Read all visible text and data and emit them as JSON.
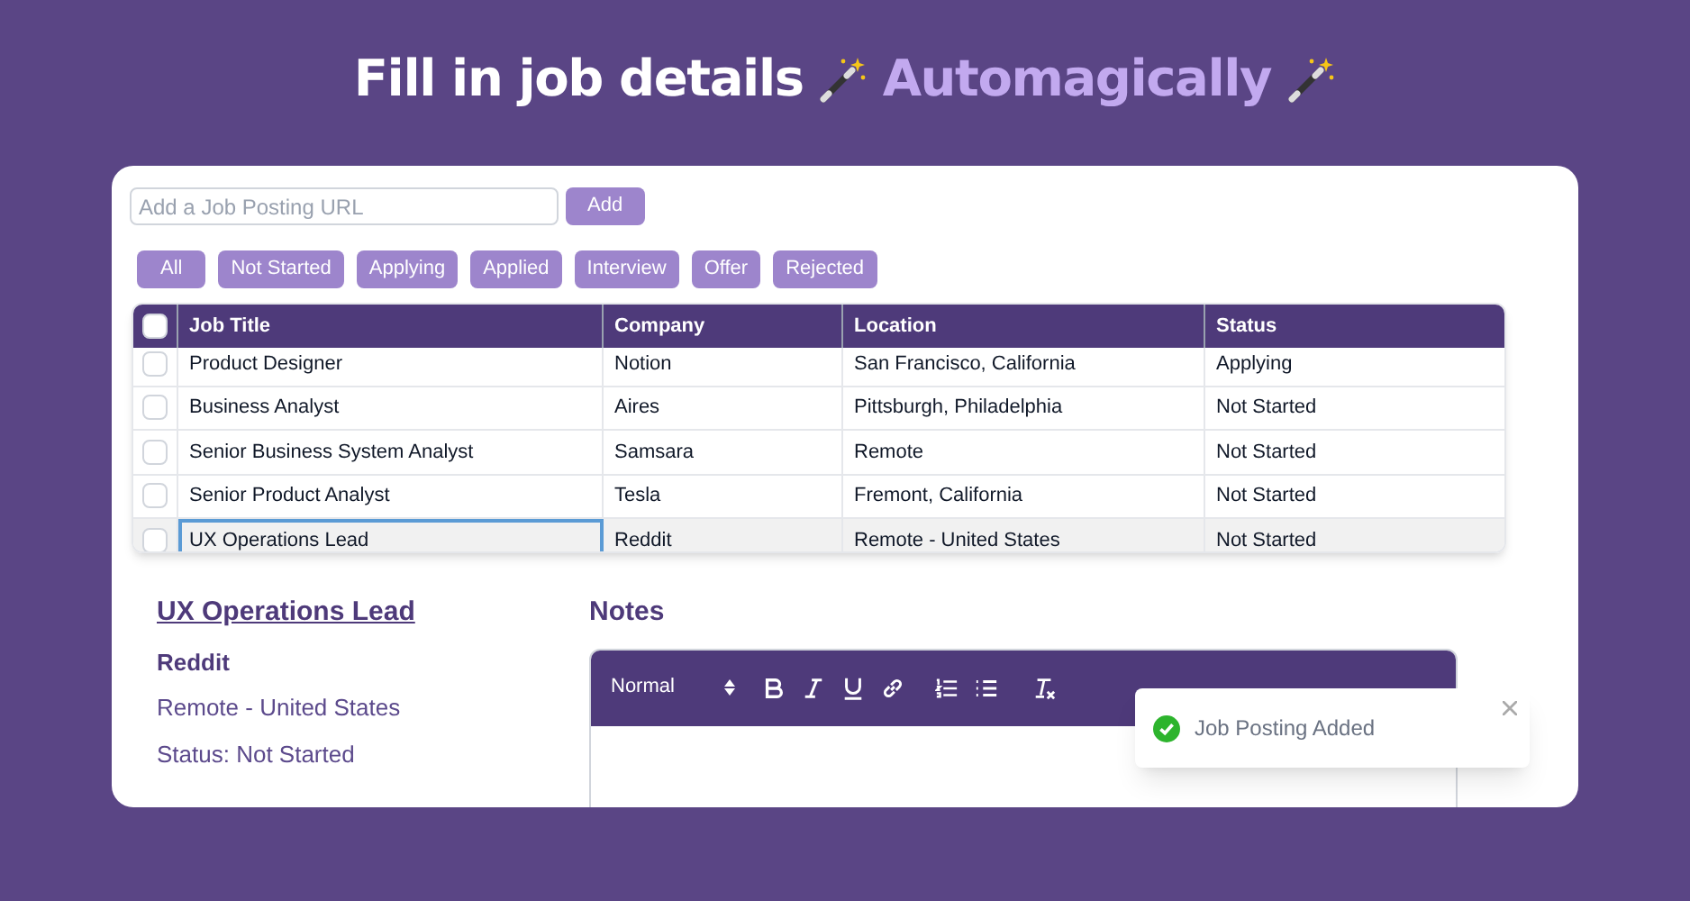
{
  "headline": {
    "text": "Fill in job details",
    "accent": "Automagically"
  },
  "url_field": {
    "placeholder": "Add a Job Posting URL"
  },
  "add_button": "Add",
  "filters": [
    {
      "label": "All",
      "selected": false
    },
    {
      "label": "Not Started",
      "selected": false
    },
    {
      "label": "Applying",
      "selected": false
    },
    {
      "label": "Applied",
      "selected": false
    },
    {
      "label": "Interview",
      "selected": false
    },
    {
      "label": "Offer",
      "selected": false
    },
    {
      "label": "Rejected",
      "selected": false
    }
  ],
  "table": {
    "select_all_checked": false,
    "columns": [
      "Job Title",
      "Company",
      "Location",
      "Status"
    ],
    "rows": [
      {
        "cells": [
          "Product Designer",
          "Notion",
          "San Francisco, California",
          "Applying"
        ],
        "checked": false,
        "selected": false
      },
      {
        "cells": [
          "Business Analyst",
          "Aires",
          "Pittsburgh, Philadelphia",
          "Not Started"
        ],
        "checked": false,
        "selected": false
      },
      {
        "cells": [
          "Senior Business System Analyst",
          "Samsara",
          "Remote",
          "Not Started"
        ],
        "checked": false,
        "selected": false
      },
      {
        "cells": [
          "Senior Product Analyst",
          "Tesla",
          "Fremont, California",
          "Not Started"
        ],
        "checked": false,
        "selected": false
      },
      {
        "cells": [
          "UX Operations Lead",
          "Reddit",
          "Remote - United States",
          "Not Started"
        ],
        "checked": false,
        "selected": true
      }
    ]
  },
  "details": {
    "title": "UX Operations Lead",
    "company": "Reddit",
    "location": "Remote - United States",
    "status": "Status: Not Started"
  },
  "notes": {
    "heading": "Notes",
    "format": "Normal"
  },
  "toast": {
    "message": "Job Posting Added"
  }
}
